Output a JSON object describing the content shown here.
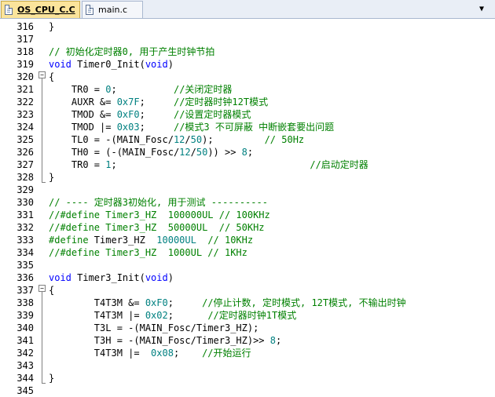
{
  "tabs": [
    {
      "label": "OS_CPU_C.C",
      "active": true
    },
    {
      "label": "main.c",
      "active": false
    }
  ],
  "dropdown_icon": "chevron-down-icon",
  "lines": [
    {
      "n": "316",
      "tokens": [
        {
          "t": "}",
          "c": ""
        }
      ]
    },
    {
      "n": "317",
      "tokens": []
    },
    {
      "n": "318",
      "tokens": [
        {
          "t": "// 初始化定时器0, 用于产生时钟节拍",
          "c": "cm"
        }
      ]
    },
    {
      "n": "319",
      "tokens": [
        {
          "t": "void",
          "c": "kw"
        },
        {
          "t": " Timer0_Init(",
          "c": ""
        },
        {
          "t": "void",
          "c": "kw"
        },
        {
          "t": ")",
          "c": ""
        }
      ]
    },
    {
      "n": "320",
      "tokens": [
        {
          "t": "{",
          "c": ""
        }
      ]
    },
    {
      "n": "321",
      "tokens": [
        {
          "t": "    TR0 = ",
          "c": ""
        },
        {
          "t": "0",
          "c": "num"
        },
        {
          "t": ";          ",
          "c": ""
        },
        {
          "t": "//关闭定时器",
          "c": "cm"
        }
      ]
    },
    {
      "n": "322",
      "tokens": [
        {
          "t": "    AUXR &= ",
          "c": ""
        },
        {
          "t": "0x7F",
          "c": "num"
        },
        {
          "t": ";     ",
          "c": ""
        },
        {
          "t": "//定时器时钟12T模式",
          "c": "cm"
        }
      ]
    },
    {
      "n": "323",
      "tokens": [
        {
          "t": "    TMOD &= ",
          "c": ""
        },
        {
          "t": "0xF0",
          "c": "num"
        },
        {
          "t": ";     ",
          "c": ""
        },
        {
          "t": "//设置定时器模式",
          "c": "cm"
        }
      ]
    },
    {
      "n": "324",
      "tokens": [
        {
          "t": "    TMOD |= ",
          "c": ""
        },
        {
          "t": "0x03",
          "c": "num"
        },
        {
          "t": ";     ",
          "c": ""
        },
        {
          "t": "//模式3 不可屏蔽 中断嵌套要出问题",
          "c": "cm"
        }
      ]
    },
    {
      "n": "325",
      "tokens": [
        {
          "t": "    TL0 = -(MAIN_Fosc/",
          "c": ""
        },
        {
          "t": "12",
          "c": "num"
        },
        {
          "t": "/",
          "c": ""
        },
        {
          "t": "50",
          "c": "num"
        },
        {
          "t": ");         ",
          "c": ""
        },
        {
          "t": "// 50Hz",
          "c": "cm"
        }
      ]
    },
    {
      "n": "326",
      "tokens": [
        {
          "t": "    TH0 = (-(MAIN_Fosc/",
          "c": ""
        },
        {
          "t": "12",
          "c": "num"
        },
        {
          "t": "/",
          "c": ""
        },
        {
          "t": "50",
          "c": "num"
        },
        {
          "t": ")) >> ",
          "c": ""
        },
        {
          "t": "8",
          "c": "num"
        },
        {
          "t": ";",
          "c": ""
        }
      ]
    },
    {
      "n": "327",
      "tokens": [
        {
          "t": "    TR0 = ",
          "c": ""
        },
        {
          "t": "1",
          "c": "num"
        },
        {
          "t": ";                                  ",
          "c": ""
        },
        {
          "t": "//启动定时器",
          "c": "cm"
        }
      ]
    },
    {
      "n": "328",
      "tokens": [
        {
          "t": "}",
          "c": ""
        }
      ]
    },
    {
      "n": "329",
      "tokens": []
    },
    {
      "n": "330",
      "tokens": [
        {
          "t": "// ---- 定时器3初始化, 用于测试 ----------",
          "c": "cm"
        }
      ]
    },
    {
      "n": "331",
      "tokens": [
        {
          "t": "//#define Timer3_HZ  100000UL // 100KHz",
          "c": "cm"
        }
      ]
    },
    {
      "n": "332",
      "tokens": [
        {
          "t": "//#define Timer3_HZ  50000UL  // 50KHz",
          "c": "cm"
        }
      ]
    },
    {
      "n": "333",
      "tokens": [
        {
          "t": "#define",
          "c": "pp"
        },
        {
          "t": " Timer3_HZ  ",
          "c": ""
        },
        {
          "t": "10000UL",
          "c": "num"
        },
        {
          "t": "  ",
          "c": ""
        },
        {
          "t": "// 10KHz",
          "c": "cm"
        }
      ]
    },
    {
      "n": "334",
      "tokens": [
        {
          "t": "//#define Timer3_HZ  1000UL // 1KHz",
          "c": "cm"
        }
      ]
    },
    {
      "n": "335",
      "tokens": []
    },
    {
      "n": "336",
      "tokens": [
        {
          "t": "void",
          "c": "kw"
        },
        {
          "t": " Timer3_Init(",
          "c": ""
        },
        {
          "t": "void",
          "c": "kw"
        },
        {
          "t": ")",
          "c": ""
        }
      ]
    },
    {
      "n": "337",
      "tokens": [
        {
          "t": "{",
          "c": ""
        }
      ]
    },
    {
      "n": "338",
      "tokens": [
        {
          "t": "        T4T3M &= ",
          "c": ""
        },
        {
          "t": "0xF0",
          "c": "num"
        },
        {
          "t": ";     ",
          "c": ""
        },
        {
          "t": "//停止计数, 定时模式, 12T模式, 不输出时钟",
          "c": "cm"
        }
      ]
    },
    {
      "n": "339",
      "tokens": [
        {
          "t": "        T4T3M |= ",
          "c": ""
        },
        {
          "t": "0x02",
          "c": "num"
        },
        {
          "t": ";      ",
          "c": ""
        },
        {
          "t": "//定时器时钟1T模式",
          "c": "cm"
        }
      ]
    },
    {
      "n": "340",
      "tokens": [
        {
          "t": "        T3L = -(MAIN_Fosc/Timer3_HZ);",
          "c": ""
        }
      ]
    },
    {
      "n": "341",
      "tokens": [
        {
          "t": "        T3H = -(MAIN_Fosc/Timer3_HZ)>> ",
          "c": ""
        },
        {
          "t": "8",
          "c": "num"
        },
        {
          "t": ";",
          "c": ""
        }
      ]
    },
    {
      "n": "342",
      "tokens": [
        {
          "t": "        T4T3M |=  ",
          "c": ""
        },
        {
          "t": "0x08",
          "c": "num"
        },
        {
          "t": ";    ",
          "c": ""
        },
        {
          "t": "//开始运行",
          "c": "cm"
        }
      ]
    },
    {
      "n": "343",
      "tokens": []
    },
    {
      "n": "344",
      "tokens": [
        {
          "t": "}",
          "c": ""
        }
      ]
    },
    {
      "n": "345",
      "tokens": []
    }
  ]
}
